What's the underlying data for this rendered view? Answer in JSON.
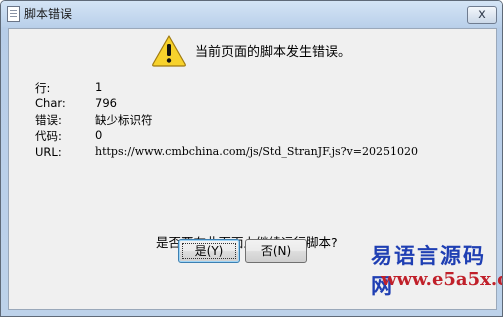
{
  "window": {
    "title": "脚本错误",
    "close_glyph": "x"
  },
  "dialog": {
    "icon": "warning-icon",
    "headline": "当前页面的脚本发生错误。",
    "details": [
      {
        "label": "行:",
        "value": "1"
      },
      {
        "label": "Char:",
        "value": "796"
      },
      {
        "label": "错误:",
        "value": "缺少标识符"
      },
      {
        "label": "代码:",
        "value": "0"
      },
      {
        "label": "URL:",
        "value": "https://www.cmbchina.com/js/Std_StranJF.js?v=20251020"
      }
    ],
    "prompt": "是否要在此页面上继续运行脚本?",
    "buttons": {
      "yes_label": "是(Y)",
      "no_label": "否(N)"
    }
  },
  "watermark": {
    "title": "易语言源码网",
    "url": "www.e5a5x.com"
  },
  "colors": {
    "titlebar": "#bad0ea",
    "client": "#f0f0f0",
    "warning_yellow": "#f7d22c",
    "watermark_blue": "#1f3fb3",
    "watermark_red": "#c0202a"
  }
}
